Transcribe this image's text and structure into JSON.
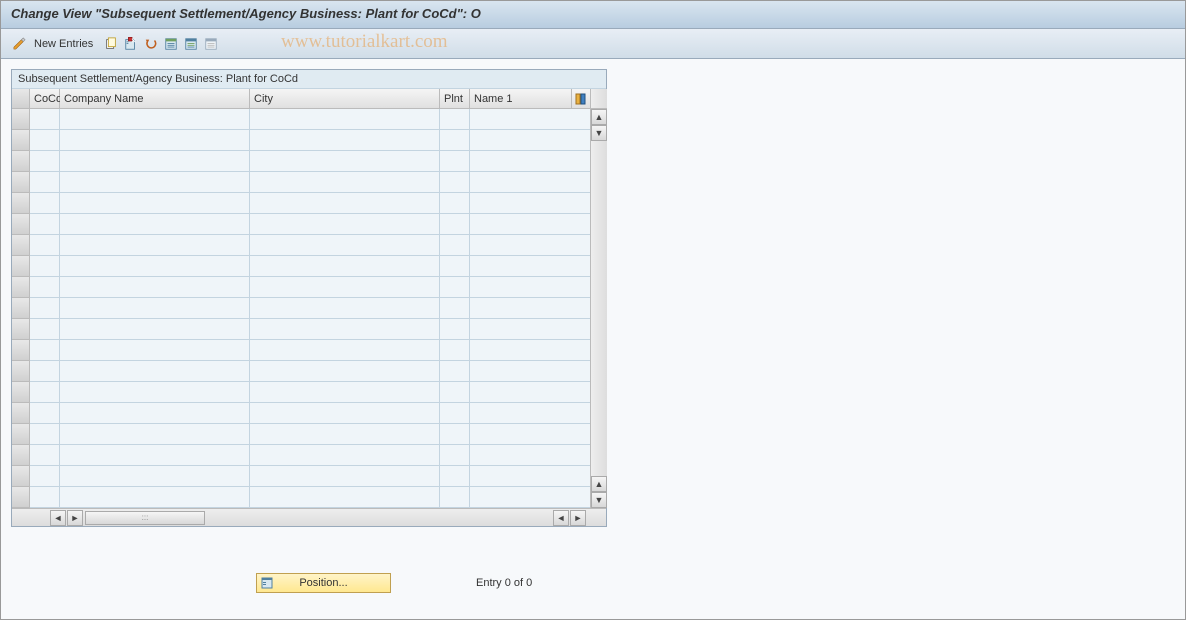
{
  "title": "Change View \"Subsequent Settlement/Agency Business: Plant for CoCd\": O",
  "toolbar": {
    "new_entries_label": "New Entries",
    "icons": {
      "toggle": "toggle-change-icon",
      "copy": "copy-icon",
      "delete": "delete-icon",
      "undo": "undo-icon",
      "select_all": "select-all-icon",
      "select_block": "select-block-icon",
      "deselect_all": "deselect-all-icon"
    }
  },
  "watermark": "www.tutorialkart.com",
  "table": {
    "title": "Subsequent Settlement/Agency Business: Plant for CoCd",
    "columns": {
      "cocd": "CoCd",
      "company_name": "Company Name",
      "city": "City",
      "plnt": "Plnt",
      "name1": "Name 1"
    },
    "rows": [
      {},
      {},
      {},
      {},
      {},
      {},
      {},
      {},
      {},
      {},
      {},
      {},
      {},
      {},
      {},
      {},
      {},
      {},
      {}
    ]
  },
  "footer": {
    "position_label": "Position...",
    "entry_text": "Entry 0 of 0"
  },
  "colors": {
    "title_gradient_top": "#d9e5f0",
    "title_gradient_bottom": "#b8cde0",
    "table_bg": "#eff5f9",
    "position_btn_bg": "#ffe890"
  }
}
